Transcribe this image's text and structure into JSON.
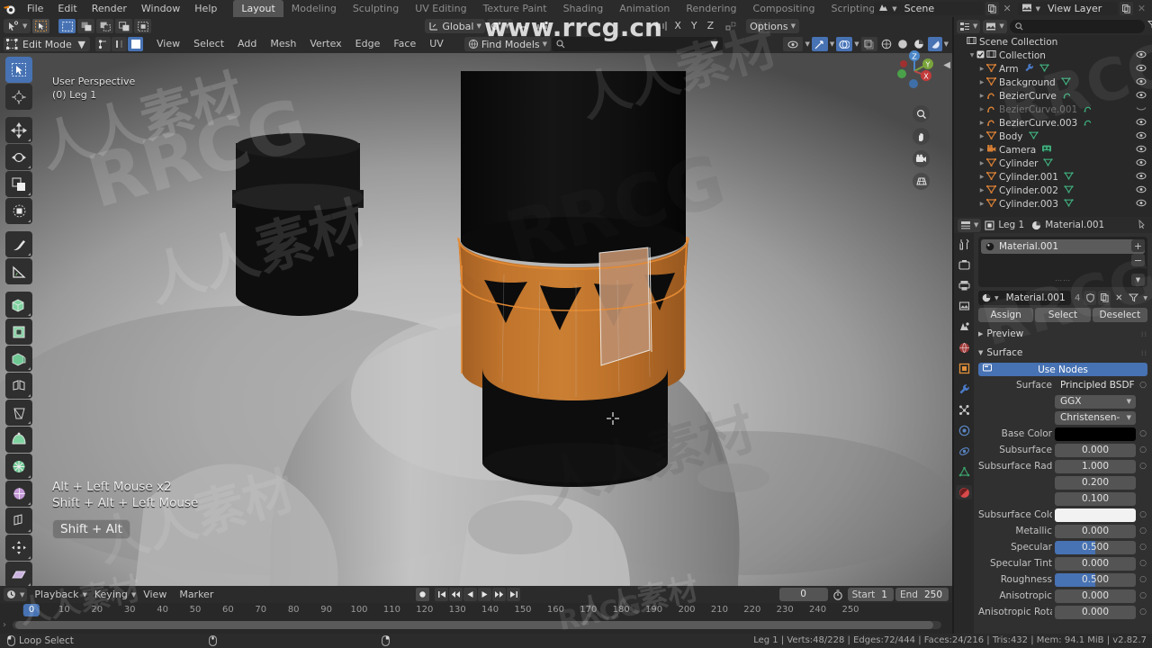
{
  "app": {
    "title": "Blender",
    "version_status": "Leg 1 | Verts:48/228 | Edges:72/444 | Faces:24/216 | Tris:432 | Mem: 94.1 MiB | v2.82.7"
  },
  "topbar": {
    "logo_icon": "blender-logo-icon",
    "menus": [
      "File",
      "Edit",
      "Render",
      "Window",
      "Help"
    ],
    "workspace_tabs": [
      {
        "label": "Layout",
        "active": true
      },
      {
        "label": "Modeling",
        "active": false
      },
      {
        "label": "Sculpting",
        "active": false
      },
      {
        "label": "UV Editing",
        "active": false
      },
      {
        "label": "Texture Paint",
        "active": false
      },
      {
        "label": "Shading",
        "active": false
      },
      {
        "label": "Animation",
        "active": false
      },
      {
        "label": "Rendering",
        "active": false
      },
      {
        "label": "Compositing",
        "active": false
      },
      {
        "label": "Scripting",
        "active": false
      }
    ],
    "add_workspace_label": "+",
    "scene_name": "Scene",
    "view_layer_name": "View Layer",
    "scene_icon": "scene-icon",
    "viewlayer_icon": "view-layer-icon",
    "copy_icon": "duplicate-icon",
    "close_icon": "x-icon"
  },
  "watermark": {
    "url": "www.rrcg.cn",
    "text_cn": "人人素材",
    "text_en": "RRCG"
  },
  "viewport": {
    "tool_header": {
      "cursor_tool_icon": "cursor-tool-icon",
      "select_tool_icon": "tweak-select-icon",
      "falloff_icons": [
        "select-box-icon",
        "select-circle-icon",
        "select-lasso-icon",
        "select-extend-icon",
        "select-invert-icon"
      ],
      "orientation_label": "Global",
      "orientation_icon": "transform-orientation-icon",
      "pivot_icon": "pivot-point-icon",
      "snap_icon": "snap-magnet-icon",
      "proportional_icon": "proportional-editing-icon",
      "mirror_icon": "mirror-icon",
      "axis_x": "X",
      "axis_y": "Y",
      "axis_z": "Z",
      "auto_merge_icon": "auto-merge-icon",
      "options_label": "Options"
    },
    "header": {
      "mode_label": "Edit Mode",
      "mode_icon": "edit-mode-icon",
      "select_modes": [
        "vertex-select-icon",
        "edge-select-icon",
        "face-select-icon"
      ],
      "menus": [
        "View",
        "Select",
        "Add",
        "Mesh",
        "Vertex",
        "Edge",
        "Face",
        "UV"
      ],
      "find_models_label": "Find Models",
      "find_models_icon": "globe-icon",
      "search_icon": "search-icon",
      "search_value": "",
      "xray_icon": "xray-icon",
      "visibility_icon": "visibility-icon",
      "gizmo_icon": "gizmo-icon",
      "overlays_icon": "overlays-icon",
      "shading_modes": [
        "wireframe-icon",
        "solid-icon",
        "material-preview-icon",
        "rendered-icon"
      ]
    },
    "tools": [
      {
        "name": "tweak-tool",
        "icon": "cursor-arrow-icon",
        "active": true
      },
      {
        "name": "cursor-tool",
        "icon": "3d-cursor-icon",
        "active": false
      },
      {
        "name": "move-tool",
        "icon": "move-arrows-icon",
        "active": false
      },
      {
        "name": "rotate-tool",
        "icon": "rotate-icon",
        "active": false
      },
      {
        "name": "scale-tool",
        "icon": "scale-icon",
        "active": false
      },
      {
        "name": "transform-tool",
        "icon": "transform-icon",
        "active": false
      },
      {
        "name": "annotate-tool",
        "icon": "pencil-icon",
        "active": false
      },
      {
        "name": "measure-tool",
        "icon": "ruler-icon",
        "active": false
      },
      {
        "name": "extrude-region-tool",
        "icon": "extrude-icon",
        "active": false
      },
      {
        "name": "inset-faces-tool",
        "icon": "inset-icon",
        "active": false
      },
      {
        "name": "bevel-tool",
        "icon": "bevel-icon",
        "active": false
      },
      {
        "name": "loop-cut-tool",
        "icon": "loop-cut-icon",
        "active": false
      },
      {
        "name": "knife-tool",
        "icon": "knife-icon",
        "active": false
      },
      {
        "name": "poly-build-tool",
        "icon": "poly-build-icon",
        "active": false
      },
      {
        "name": "spin-tool",
        "icon": "spin-icon",
        "active": false
      },
      {
        "name": "smooth-tool",
        "icon": "smooth-icon",
        "active": false
      },
      {
        "name": "edge-slide-tool",
        "icon": "edge-slide-icon",
        "active": false
      },
      {
        "name": "shrink-fatten-tool",
        "icon": "shrink-fatten-icon",
        "active": false
      },
      {
        "name": "shear-tool",
        "icon": "shear-icon",
        "active": false
      },
      {
        "name": "rip-region-tool",
        "icon": "rip-region-icon",
        "active": false
      }
    ],
    "overlay_info": {
      "perspective": "User Perspective",
      "object": "(0) Leg 1"
    },
    "key_hints": {
      "line1": "Alt + Left Mouse x2",
      "line2": "Shift + Alt + Left Mouse",
      "keybox": "Shift + Alt"
    },
    "gizmo_axes": [
      "X",
      "Y",
      "Z"
    ],
    "nav_buttons": [
      "zoom-icon",
      "pan-hand-icon",
      "camera-view-icon",
      "ortho-persp-icon"
    ],
    "colors": {
      "accent_orange": "#d07a2e",
      "mesh_black": "#0d0d0d",
      "selected_face": "#b98a6a",
      "background_grey": "#9e9e9e"
    }
  },
  "outliner": {
    "display_mode_icon": "outliner-display-icon",
    "filter_icon": "filter-funnel-icon",
    "new_collection_icon": "new-collection-icon",
    "search_icon": "search-icon",
    "search_value": "",
    "rows": [
      {
        "label": "Scene Collection",
        "icon": "collection-icon",
        "indent": 0,
        "dim": false,
        "eye": false,
        "checkbox": false,
        "disclose": ""
      },
      {
        "label": "Collection",
        "icon": "collection-icon",
        "indent": 1,
        "dim": false,
        "eye": true,
        "checkbox": true,
        "disclose": "▼"
      },
      {
        "label": "Arm",
        "icon": "mesh-data-icon",
        "indent": 2,
        "dim": false,
        "eye": true,
        "checkbox": false,
        "disclose": "▶",
        "extras": [
          "modifier-icon",
          "mesh-triangle-icon"
        ]
      },
      {
        "label": "Background",
        "icon": "mesh-data-icon",
        "indent": 2,
        "dim": false,
        "eye": true,
        "checkbox": false,
        "disclose": "▶",
        "extras": [
          "mesh-triangle-icon"
        ]
      },
      {
        "label": "BezierCurve",
        "icon": "curve-icon",
        "indent": 2,
        "dim": false,
        "eye": true,
        "checkbox": false,
        "disclose": "▶",
        "extras": [
          "curve-data-icon"
        ]
      },
      {
        "label": "BezierCurve.001",
        "icon": "curve-icon",
        "indent": 2,
        "dim": true,
        "eye": false,
        "checkbox": false,
        "disclose": "▶",
        "extras": [
          "curve-data-icon"
        ]
      },
      {
        "label": "BezierCurve.003",
        "icon": "curve-icon",
        "indent": 2,
        "dim": false,
        "eye": true,
        "checkbox": false,
        "disclose": "▶",
        "extras": [
          "curve-data-icon"
        ]
      },
      {
        "label": "Body",
        "icon": "mesh-data-icon",
        "indent": 2,
        "dim": false,
        "eye": true,
        "checkbox": false,
        "disclose": "▶",
        "extras": [
          "mesh-triangle-icon"
        ]
      },
      {
        "label": "Camera",
        "icon": "camera-icon",
        "indent": 2,
        "dim": false,
        "eye": true,
        "checkbox": false,
        "disclose": "▶",
        "extras": [
          "camera-data-icon"
        ]
      },
      {
        "label": "Cylinder",
        "icon": "mesh-data-icon",
        "indent": 2,
        "dim": false,
        "eye": true,
        "checkbox": false,
        "disclose": "▶",
        "extras": [
          "mesh-triangle-icon"
        ]
      },
      {
        "label": "Cylinder.001",
        "icon": "mesh-data-icon",
        "indent": 2,
        "dim": false,
        "eye": true,
        "checkbox": false,
        "disclose": "▶",
        "extras": [
          "mesh-triangle-icon"
        ]
      },
      {
        "label": "Cylinder.002",
        "icon": "mesh-data-icon",
        "indent": 2,
        "dim": false,
        "eye": true,
        "checkbox": false,
        "disclose": "▶",
        "extras": [
          "mesh-triangle-icon"
        ]
      },
      {
        "label": "Cylinder.003",
        "icon": "mesh-data-icon",
        "indent": 2,
        "dim": false,
        "eye": true,
        "checkbox": false,
        "disclose": "▶",
        "extras": [
          "mesh-triangle-icon"
        ]
      }
    ]
  },
  "properties": {
    "breadcrumb": {
      "editor_icon": "properties-editor-icon",
      "object_icon": "object-icon",
      "object_name": "Leg 1",
      "material_icon": "material-sphere-icon",
      "material_name": "Material.001",
      "pin_icon": "pin-icon"
    },
    "tabs": [
      {
        "name": "tool-tab",
        "icon": "tool-wrench-screwdriver-icon",
        "active": false
      },
      {
        "name": "render-tab",
        "icon": "render-camera-back-icon",
        "active": false
      },
      {
        "name": "output-tab",
        "icon": "printer-icon",
        "active": false
      },
      {
        "name": "view-layer-tab",
        "icon": "images-icon",
        "active": false
      },
      {
        "name": "scene-tab",
        "icon": "scene-cone-icon",
        "active": false
      },
      {
        "name": "world-tab",
        "icon": "world-globe-icon",
        "active": false
      },
      {
        "name": "object-tab",
        "icon": "object-square-icon",
        "active": false
      },
      {
        "name": "modifier-tab",
        "icon": "wrench-icon",
        "active": false
      },
      {
        "name": "particles-tab",
        "icon": "particles-icon",
        "active": false
      },
      {
        "name": "physics-tab",
        "icon": "physics-orbit-icon",
        "active": false
      },
      {
        "name": "constraints-tab",
        "icon": "constraint-icon",
        "active": false
      },
      {
        "name": "data-tab",
        "icon": "mesh-data-green-icon",
        "active": false
      },
      {
        "name": "material-tab",
        "icon": "material-sphere-icon",
        "active": true
      }
    ],
    "material_slots": [
      {
        "name": "Material.001",
        "selected": true
      }
    ],
    "slot_buttons": [
      "plus-icon",
      "minus-icon",
      "chevron-down-icon"
    ],
    "material_field": {
      "browse_icon": "material-browse-icon",
      "name": "Material.001",
      "users": "4",
      "shield_icon": "fake-user-shield-icon",
      "new_icon": "new-material-icon",
      "unlink_icon": "unlink-x-icon",
      "filter_icon": "filter-funnel-icon"
    },
    "assign_buttons": [
      "Assign",
      "Select",
      "Deselect"
    ],
    "panels": [
      {
        "label": "Preview",
        "open": false
      },
      {
        "label": "Surface",
        "open": true
      }
    ],
    "use_nodes_label": "Use Nodes",
    "surface_rows": [
      {
        "label": "Surface",
        "value": "Principled BSDF",
        "type": "dropdown-flat",
        "dot": true
      },
      {
        "label": "",
        "value": "GGX",
        "type": "dropdown",
        "dot": false
      },
      {
        "label": "",
        "value": "Christensen-Burley",
        "type": "dropdown",
        "dot": false
      },
      {
        "label": "Base Color",
        "value": "",
        "type": "swatch-black",
        "dot": true
      },
      {
        "label": "Subsurface",
        "value": "0.000",
        "type": "slider",
        "fill": 0,
        "dot": true
      },
      {
        "label": "Subsurface Radius",
        "value": "1.000",
        "type": "value",
        "dot": true
      },
      {
        "label": "",
        "value": "0.200",
        "type": "value",
        "dot": false
      },
      {
        "label": "",
        "value": "0.100",
        "type": "value",
        "dot": false
      },
      {
        "label": "Subsurface Color",
        "value": "",
        "type": "swatch-white",
        "dot": true
      },
      {
        "label": "Metallic",
        "value": "0.000",
        "type": "slider",
        "fill": 0,
        "dot": true
      },
      {
        "label": "Specular",
        "value": "0.500",
        "type": "slider",
        "fill": 50,
        "dot": true
      },
      {
        "label": "Specular Tint",
        "value": "0.000",
        "type": "slider",
        "fill": 0,
        "dot": true
      },
      {
        "label": "Roughness",
        "value": "0.500",
        "type": "slider",
        "fill": 50,
        "dot": true
      },
      {
        "label": "Anisotropic",
        "value": "0.000",
        "type": "slider",
        "fill": 0,
        "dot": true
      },
      {
        "label": "Anisotropic Rotati..",
        "value": "0.000",
        "type": "slider",
        "fill": 0,
        "dot": true
      }
    ]
  },
  "timeline": {
    "editor_icon": "timeline-editor-icon",
    "menus": [
      "Playback",
      "Keying",
      "View",
      "Marker"
    ],
    "transport": [
      "record-icon",
      "jump-start-icon",
      "prev-keyframe-icon",
      "play-reverse-icon",
      "play-icon",
      "next-keyframe-icon",
      "jump-end-icon"
    ],
    "current_frame": "0",
    "auto_key_icon": "auto-keying-icon",
    "start_label": "Start",
    "start_value": "1",
    "end_label": "End",
    "end_value": "250",
    "playhead_frame": "0",
    "ticks": [
      0,
      10,
      20,
      30,
      40,
      50,
      60,
      70,
      80,
      90,
      100,
      110,
      120,
      130,
      140,
      150,
      160,
      170,
      180,
      190,
      200,
      210,
      220,
      230,
      240,
      250
    ]
  },
  "statusbar": {
    "mouse_icon": "left-mouse-icon",
    "action_label": "Loop Select",
    "middle_icon": "middle-mouse-icon",
    "right_icon": "right-mouse-icon",
    "stats": "Leg 1 | Verts:48/228 | Edges:72/444 | Faces:24/216 | Tris:432 | Mem: 94.1 MiB | v2.82.7"
  }
}
